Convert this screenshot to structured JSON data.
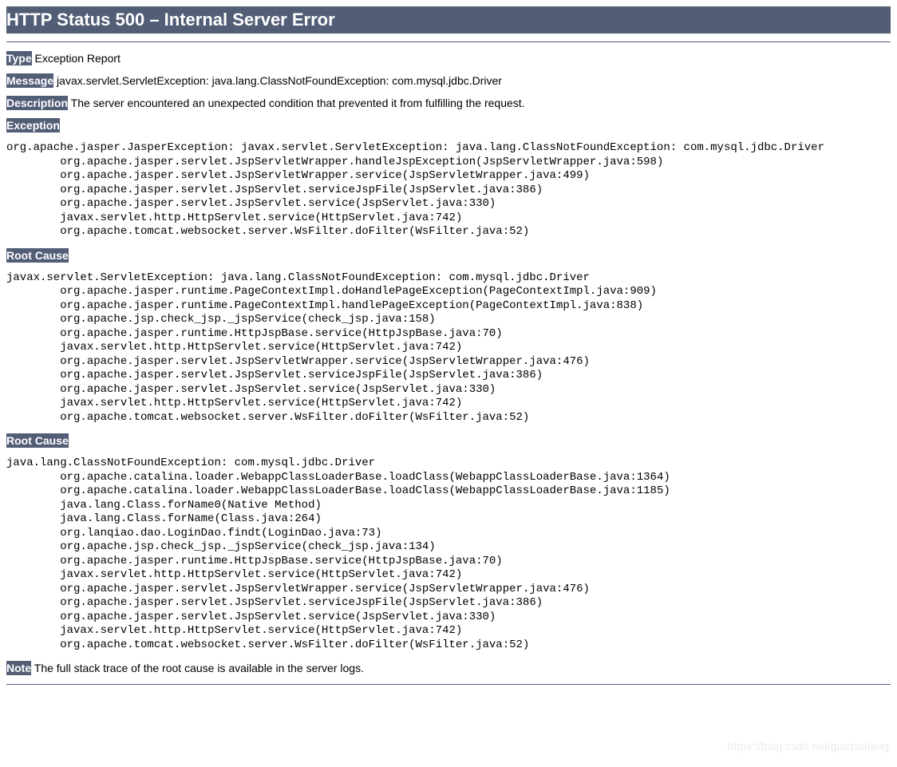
{
  "heading": "HTTP Status 500 – Internal Server Error",
  "labels": {
    "type": "Type",
    "message": "Message",
    "description": "Description",
    "exception": "Exception",
    "rootcause1": "Root Cause",
    "rootcause2": "Root Cause",
    "note": "Note"
  },
  "values": {
    "type": "Exception Report",
    "message": "javax.servlet.ServletException: java.lang.ClassNotFoundException: com.mysql.jdbc.Driver",
    "description": "The server encountered an unexpected condition that prevented it from fulfilling the request.",
    "note": "The full stack trace of the root cause is available in the server logs."
  },
  "stacks": {
    "exception": "org.apache.jasper.JasperException: javax.servlet.ServletException: java.lang.ClassNotFoundException: com.mysql.jdbc.Driver\n\torg.apache.jasper.servlet.JspServletWrapper.handleJspException(JspServletWrapper.java:598)\n\torg.apache.jasper.servlet.JspServletWrapper.service(JspServletWrapper.java:499)\n\torg.apache.jasper.servlet.JspServlet.serviceJspFile(JspServlet.java:386)\n\torg.apache.jasper.servlet.JspServlet.service(JspServlet.java:330)\n\tjavax.servlet.http.HttpServlet.service(HttpServlet.java:742)\n\torg.apache.tomcat.websocket.server.WsFilter.doFilter(WsFilter.java:52)",
    "rootcause1": "javax.servlet.ServletException: java.lang.ClassNotFoundException: com.mysql.jdbc.Driver\n\torg.apache.jasper.runtime.PageContextImpl.doHandlePageException(PageContextImpl.java:909)\n\torg.apache.jasper.runtime.PageContextImpl.handlePageException(PageContextImpl.java:838)\n\torg.apache.jsp.check_jsp._jspService(check_jsp.java:158)\n\torg.apache.jasper.runtime.HttpJspBase.service(HttpJspBase.java:70)\n\tjavax.servlet.http.HttpServlet.service(HttpServlet.java:742)\n\torg.apache.jasper.servlet.JspServletWrapper.service(JspServletWrapper.java:476)\n\torg.apache.jasper.servlet.JspServlet.serviceJspFile(JspServlet.java:386)\n\torg.apache.jasper.servlet.JspServlet.service(JspServlet.java:330)\n\tjavax.servlet.http.HttpServlet.service(HttpServlet.java:742)\n\torg.apache.tomcat.websocket.server.WsFilter.doFilter(WsFilter.java:52)",
    "rootcause2": "java.lang.ClassNotFoundException: com.mysql.jdbc.Driver\n\torg.apache.catalina.loader.WebappClassLoaderBase.loadClass(WebappClassLoaderBase.java:1364)\n\torg.apache.catalina.loader.WebappClassLoaderBase.loadClass(WebappClassLoaderBase.java:1185)\n\tjava.lang.Class.forName0(Native Method)\n\tjava.lang.Class.forName(Class.java:264)\n\torg.lanqiao.dao.LoginDao.findt(LoginDao.java:73)\n\torg.apache.jsp.check_jsp._jspService(check_jsp.java:134)\n\torg.apache.jasper.runtime.HttpJspBase.service(HttpJspBase.java:70)\n\tjavax.servlet.http.HttpServlet.service(HttpServlet.java:742)\n\torg.apache.jasper.servlet.JspServletWrapper.service(JspServletWrapper.java:476)\n\torg.apache.jasper.servlet.JspServlet.serviceJspFile(JspServlet.java:386)\n\torg.apache.jasper.servlet.JspServlet.service(JspServlet.java:330)\n\tjavax.servlet.http.HttpServlet.service(HttpServlet.java:742)\n\torg.apache.tomcat.websocket.server.WsFilter.doFilter(WsFilter.java:52)"
  },
  "watermark": "https://blog.csdn.net/guozuofeng"
}
